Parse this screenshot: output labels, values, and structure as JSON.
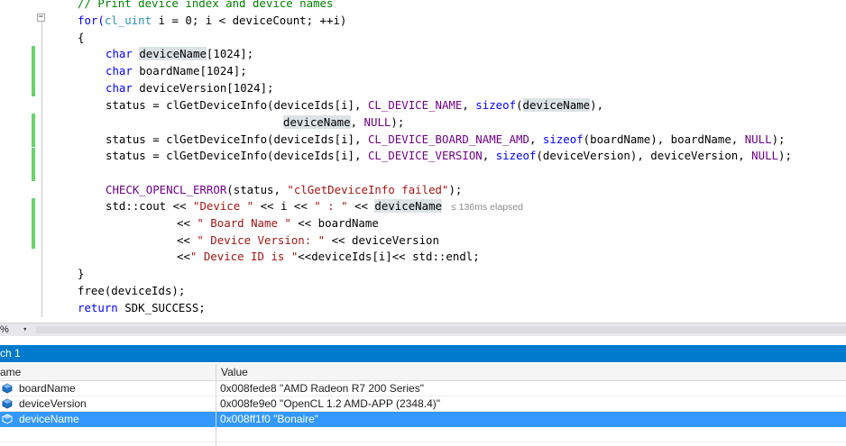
{
  "editor": {
    "comment_line": "// Print device index and device names",
    "lines": {
      "l1a": "for(",
      "l1b": "cl_uint",
      "l1c": " i = 0; i < deviceCount; ++i)",
      "l2": "{",
      "l3kw": "char",
      "l3a": "deviceName",
      "l3b": "[1024];",
      "l4kw": "char",
      "l4a": " boardName[1024];",
      "l5kw": "char",
      "l5a": " deviceVersion[1024];",
      "l6a": "status = clGetDeviceInfo(deviceIds[i], ",
      "l6mac": "CL_DEVICE_NAME",
      "l6b": ", ",
      "l6kw": "sizeof",
      "l6c": "(",
      "l6hl": "deviceName",
      "l6d": "),",
      "l7hl": "deviceName",
      "l7a": ", ",
      "l7mac": "NULL",
      "l7b": ");",
      "l8a": "status = clGetDeviceInfo(deviceIds[i], ",
      "l8mac": "CL_DEVICE_BOARD_NAME_AMD",
      "l8b": ", ",
      "l8kw": "sizeof",
      "l8c": "(boardName), boardName, ",
      "l8mac2": "NULL",
      "l8d": ");",
      "l9a": "status = clGetDeviceInfo(deviceIds[i], ",
      "l9mac": "CL_DEVICE_VERSION",
      "l9b": ", ",
      "l9kw": "sizeof",
      "l9c": "(deviceVersion), deviceVersion, ",
      "l9mac2": "NULL",
      "l9d": ");",
      "l10mac": "CHECK_OPENCL_ERROR",
      "l10a": "(status, ",
      "l10str": "\"clGetDeviceInfo failed\"",
      "l10b": ");",
      "l11a": "std::cout << ",
      "l11str": "\"Device \"",
      "l11b": " << i << ",
      "l11str2": "\" : \"",
      "l11c": " << ",
      "l11hl": "deviceName",
      "l11elapsed": "≤ 136ms elapsed",
      "l12a": "<< ",
      "l12str": "\" Board Name \"",
      "l12b": " << boardName",
      "l13a": "<< ",
      "l13str": "\" Device Version: \"",
      "l13b": " << deviceVersion",
      "l14a": "<<",
      "l14str": "\" Device ID is \"",
      "l14b": "<<deviceIds[i]<< std::endl;",
      "l15": "}",
      "l16": "free(deviceIds);",
      "l17kw": "return",
      "l17a": " SDK_SUCCESS;"
    }
  },
  "zoom": {
    "value": "%"
  },
  "watch": {
    "title": "ch 1",
    "columns": {
      "name": "ame",
      "value": "Value"
    },
    "rows": [
      {
        "name": "boardName",
        "value": "0x008fede8 \"AMD Radeon R7 200 Series\""
      },
      {
        "name": "deviceVersion",
        "value": "0x008fe9e0 \"OpenCL 1.2 AMD-APP (2348.4)\""
      },
      {
        "name": "deviceName",
        "value": "0x008ff1f0 \"Bonaire\""
      }
    ],
    "selected_row": "deviceName"
  },
  "colors": {
    "keyword": "#0000ff",
    "type": "#2b91af",
    "macro": "#6f008a",
    "string": "#a31515",
    "comment": "#008000",
    "change_bar": "#6ad46a",
    "watch_title": "#007acc",
    "selection": "#3399ff"
  }
}
